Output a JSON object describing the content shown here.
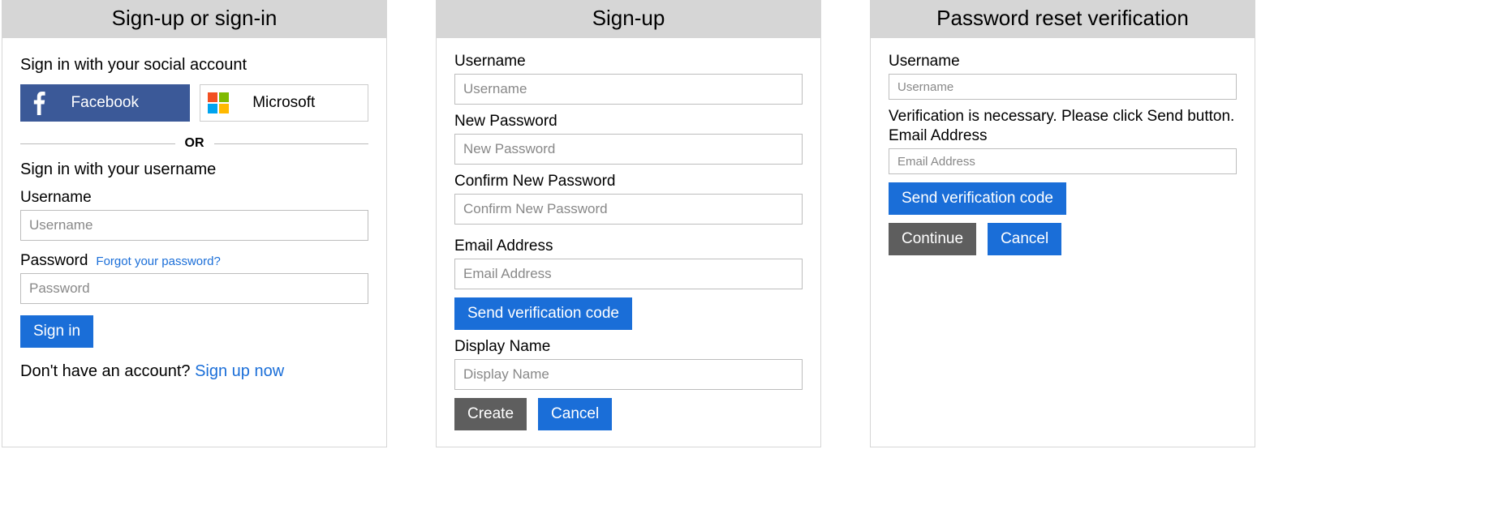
{
  "signin": {
    "title": "Sign-up or sign-in",
    "social_title": "Sign in with your social account",
    "facebook_label": "Facebook",
    "microsoft_label": "Microsoft",
    "or_label": "OR",
    "local_title": "Sign in with your username",
    "username_label": "Username",
    "username_placeholder": "Username",
    "password_label": "Password",
    "forgot_password": "Forgot your password?",
    "password_placeholder": "Password",
    "signin_button": "Sign in",
    "signup_prompt": "Don't have an account?",
    "signup_link": "Sign up now"
  },
  "signup": {
    "title": "Sign-up",
    "username_label": "Username",
    "username_placeholder": "Username",
    "newpw_label": "New Password",
    "newpw_placeholder": "New Password",
    "confirmpw_label": "Confirm New Password",
    "confirmpw_placeholder": "Confirm New Password",
    "email_label": "Email Address",
    "email_placeholder": "Email Address",
    "send_code_button": "Send verification code",
    "display_label": "Display Name",
    "display_placeholder": "Display Name",
    "create_button": "Create",
    "cancel_button": "Cancel"
  },
  "reset": {
    "title": "Password reset verification",
    "username_label": "Username",
    "username_placeholder": "Username",
    "verify_msg": "Verification is necessary. Please click Send button.",
    "email_label": "Email Address",
    "email_placeholder": "Email Address",
    "send_code_button": "Send verification code",
    "continue_button": "Continue",
    "cancel_button": "Cancel"
  }
}
